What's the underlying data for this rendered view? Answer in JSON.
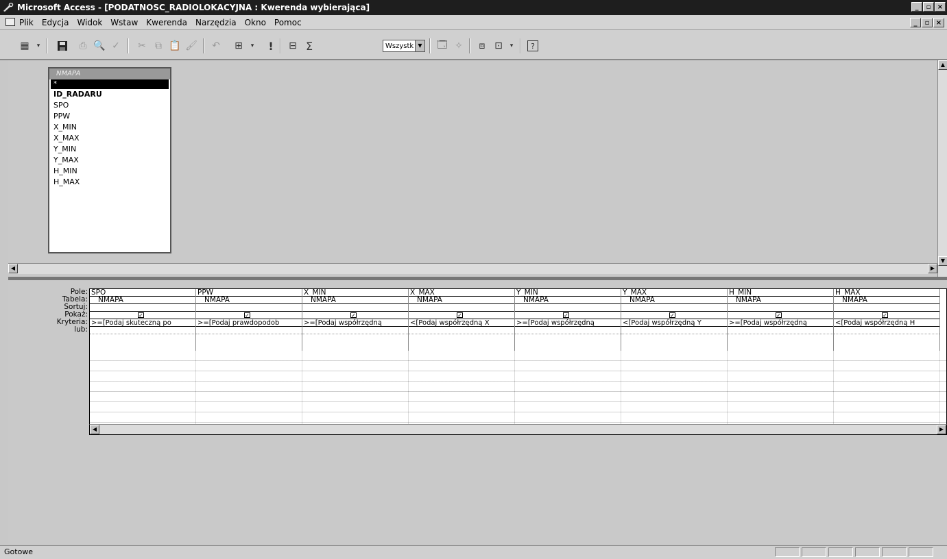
{
  "window": {
    "title": "Microsoft Access - [PODATNOSC_RADIOLOKACYJNA : Kwerenda wybierająca]"
  },
  "menu": {
    "items": [
      "Plik",
      "Edycja",
      "Widok",
      "Wstaw",
      "Kwerenda",
      "Narzędzia",
      "Okno",
      "Pomoc"
    ]
  },
  "toolbar": {
    "top_values_combo": "Wszystk",
    "run_symbol": "!",
    "sum_symbol": "Σ",
    "help_symbol": "?"
  },
  "table_box": {
    "title": "NMAPA",
    "star": "*",
    "fields": [
      "ID_RADARU",
      "SPO",
      "PPW",
      "X_MIN",
      "X_MAX",
      "Y_MIN",
      "Y_MAX",
      "H_MIN",
      "H_MAX"
    ]
  },
  "grid": {
    "row_labels": [
      "Pole:",
      "Tabela:",
      "Sortuj:",
      "Pokaż:",
      "Kryteria:",
      "lub:"
    ],
    "columns": [
      {
        "field": "SPO",
        "table": "NMAPA",
        "criteria": ">=[Podaj skuteczną po"
      },
      {
        "field": "PPW",
        "table": "NMAPA",
        "criteria": ">=[Podaj prawdopodob"
      },
      {
        "field": "X_MIN",
        "table": "NMAPA",
        "criteria": ">=[Podaj współrzędną"
      },
      {
        "field": "X_MAX",
        "table": "NMAPA",
        "criteria": "<[Podaj współrzędną X"
      },
      {
        "field": "Y_MIN",
        "table": "NMAPA",
        "criteria": ">=[Podaj współrzędną"
      },
      {
        "field": "Y_MAX",
        "table": "NMAPA",
        "criteria": "<[Podaj współrzędną Y"
      },
      {
        "field": "H_MIN",
        "table": "NMAPA",
        "criteria": ">=[Podaj współrzędną"
      },
      {
        "field": "H_MAX",
        "table": "NMAPA",
        "criteria": "<[Podaj współrzędną H"
      }
    ]
  },
  "status": {
    "text": "Gotowe"
  }
}
